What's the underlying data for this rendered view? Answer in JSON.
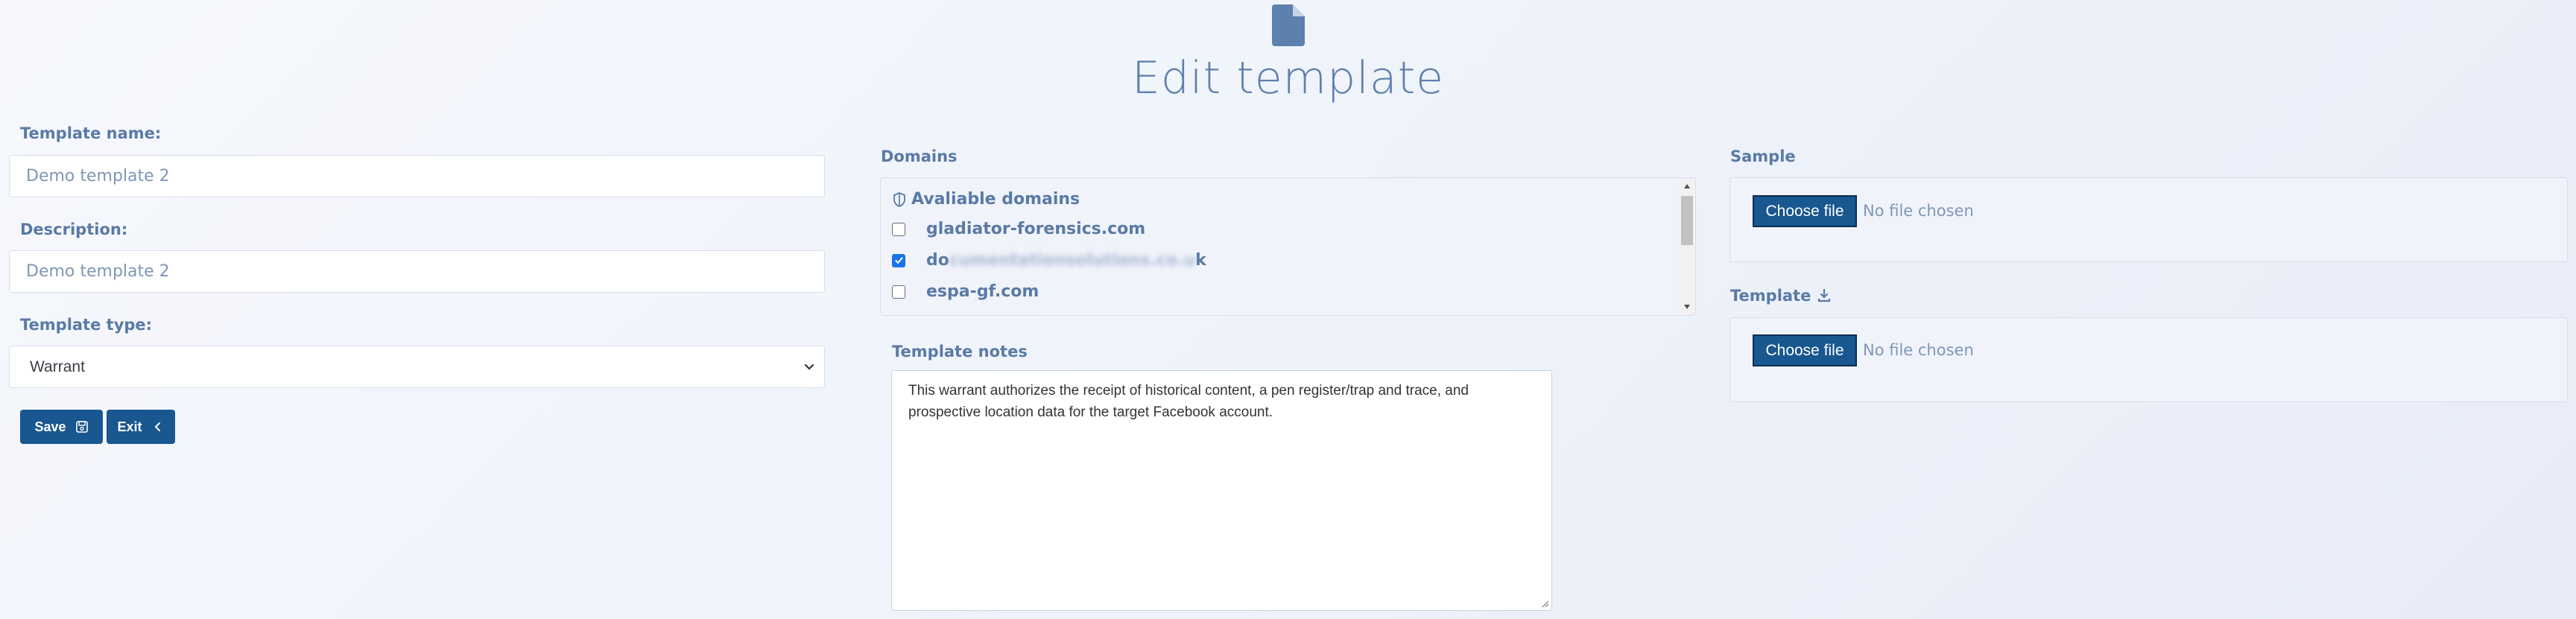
{
  "header": {
    "icon": "file-icon",
    "title": "Edit template"
  },
  "form": {
    "name_label": "Template name:",
    "name_value": "Demo template 2",
    "description_label": "Description:",
    "description_value": "Demo template 2",
    "type_label": "Template type:",
    "type_value": "Warrant",
    "save_label": "Save",
    "exit_label": "Exit"
  },
  "domains": {
    "label": "Domains",
    "header": "Avaliable domains",
    "items": [
      {
        "name": "gladiator-forensics.com",
        "checked": false
      },
      {
        "prefix": "do",
        "blurred": "cumentationsolutions.co.u",
        "suffix": "k",
        "checked": true
      },
      {
        "name": "espa-gf.com",
        "checked": false
      }
    ]
  },
  "notes": {
    "label": "Template notes",
    "text": "This warrant authorizes the receipt of historical content, a pen register/trap and trace, and prospective location data for the target Facebook account."
  },
  "sample": {
    "label": "Sample",
    "button": "Choose file",
    "status": "No file chosen"
  },
  "template_file": {
    "label": "Template",
    "icon": "download-icon",
    "button": "Choose file",
    "status": "No file chosen"
  },
  "colors": {
    "accent": "#18578f",
    "label": "#5a7aa5",
    "title": "#5e80ac"
  }
}
